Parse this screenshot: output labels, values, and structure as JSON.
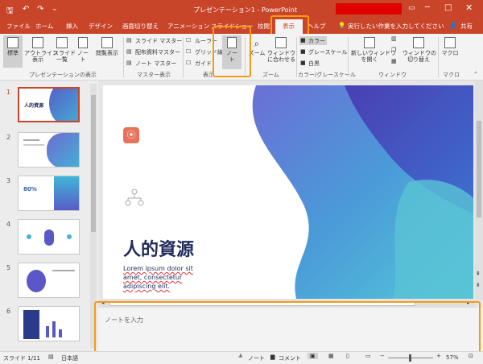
{
  "window": {
    "title": "プレゼンテーション1 - PowerPoint",
    "user_name": "",
    "controls": [
      "restore",
      "minimize",
      "maximize",
      "close"
    ]
  },
  "quick_access": [
    "save-icon",
    "undo-icon",
    "redo-icon",
    "customize-icon"
  ],
  "tabs": [
    "ファイル",
    "ホーム",
    "挿入",
    "デザイン",
    "画面切り替え",
    "アニメーション",
    "スライドショー",
    "校閲",
    "表示",
    "ヘルプ"
  ],
  "tell_me": "実行したい作業を入力してください",
  "share": "共有",
  "ribbon": {
    "views": {
      "normal": "標準",
      "outline": "アウトライン\n表示",
      "sorter": "スライド\n一覧",
      "notes_page": "ノー\nト",
      "reading": "閲覧表示",
      "label": "プレゼンテーションの表示"
    },
    "master": {
      "slide": "スライド マスター",
      "handout": "配布資料マスター",
      "notes": "ノート マスター",
      "label": "マスター表示"
    },
    "show": {
      "ruler": "ルーラー",
      "grid": "グリッド線",
      "guide": "ガイド",
      "notes_btn": "ノー\nト",
      "label": "表示"
    },
    "zoom": {
      "zoom": "ズーム",
      "fit": "ウィンドウ\nに合わせる",
      "label": "ズーム"
    },
    "color": {
      "color": "カラー",
      "grayscale": "グレースケール",
      "bw": "白黒",
      "label": "カラー/グレースケール"
    },
    "window": {
      "new": "新しいウィンドウ\nを開く",
      "switch": "ウィンドウの\n切り替え",
      "label": "ウィンドウ"
    },
    "macro": {
      "macro": "マクロ",
      "label": "マクロ"
    }
  },
  "thumbnails": [
    {
      "num": "1",
      "title": "人的資源"
    },
    {
      "num": "2",
      "title": ""
    },
    {
      "num": "3",
      "title": "80%"
    },
    {
      "num": "4",
      "title": ""
    },
    {
      "num": "5",
      "title": ""
    },
    {
      "num": "6",
      "title": ""
    }
  ],
  "slide": {
    "title": "人的資源",
    "body": "Lorem ipsum dolor sit amet, consectetur adipiscing elit."
  },
  "notes": {
    "placeholder": "ノートを入力"
  },
  "status": {
    "slide": "スライド 1/11",
    "lang": "日本語",
    "notes": "ノート",
    "comments": "コメント",
    "zoom": "57%"
  },
  "colors": {
    "accent": "#c9452a",
    "highlight": "#f39c12",
    "title": "#1f2a5c"
  }
}
